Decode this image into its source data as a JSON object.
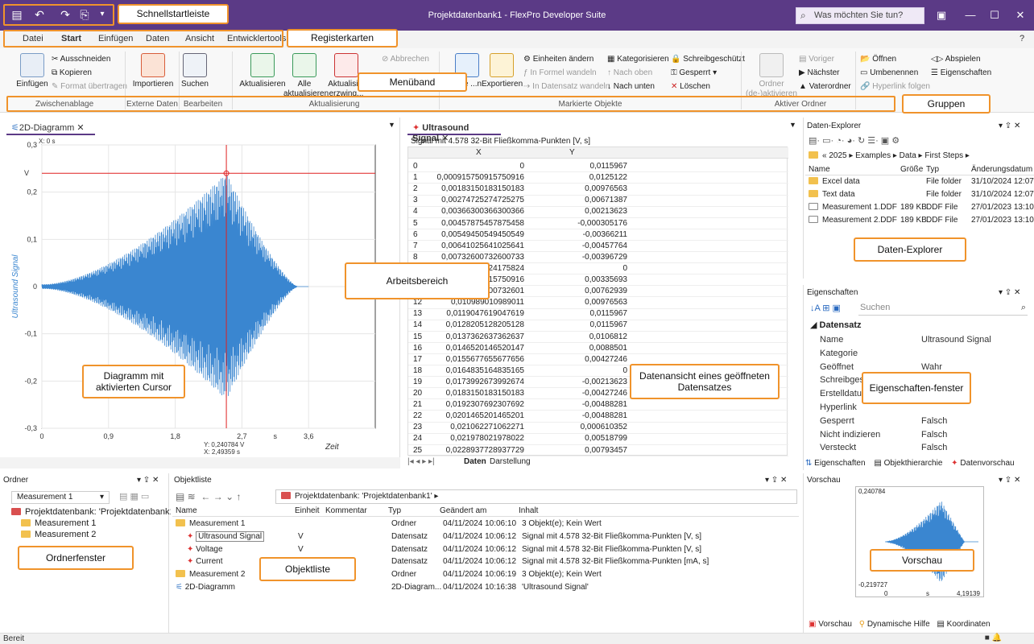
{
  "window": {
    "title": "Projektdatenbank1 - FlexPro Developer Suite",
    "search_placeholder": "Was möchten Sie tun?"
  },
  "callouts": {
    "quick_access": "Schnellstartleiste",
    "tabs": "Registerkarten",
    "ribbon": "Menüband",
    "groups": "Gruppen",
    "workspace": "Arbeitsbereich",
    "diagram_cursor": "Diagramm mit aktivierten Cursor",
    "dataset_view": "Datenansicht eines geöffneten Datensatzes",
    "explorer": "Daten-Explorer",
    "props": "Eigenschaften-fenster",
    "folder_window": "Ordnerfenster",
    "object_list": "Objektliste",
    "preview": "Vorschau"
  },
  "tabs": [
    "Datei",
    "Start",
    "Einfügen",
    "Daten",
    "Ansicht",
    "Entwicklertools"
  ],
  "ribbon": {
    "paste": "Einfügen",
    "cut": "Ausschneiden",
    "copy": "Kopieren",
    "format": "Format übertragen",
    "import": "Importieren",
    "search": "Suchen",
    "refresh": "Aktualisieren",
    "refresh_all": "Alle aktualisieren",
    "refresh_force": "Aktualisi... erzwing...",
    "cancel": "Abbrechen",
    "insert": "...ge ...n",
    "export": "Exportieren",
    "units": "Einheiten ändern",
    "to_formula": "In Formel wandeln",
    "to_dataset": "In Datensatz wandeln",
    "categorize": "Kategorisieren",
    "up": "Nach oben",
    "down": "Nach unten",
    "write_protected": "Schreibgeschützt",
    "locked": "Gesperrt",
    "delete": "Löschen",
    "folder_activate": "Ordner (de-)aktivieren",
    "prev": "Voriger",
    "next": "Nächster",
    "parent": "Vaterordner",
    "open": "Öffnen",
    "rename": "Umbenennen",
    "follow": "Hyperlink folgen",
    "play": "Abspielen",
    "properties": "Eigenschaften",
    "groups": [
      "Zwischenablage",
      "Externe Daten",
      "Bearbeiten",
      "Aktualisierung",
      "Markierte Objekte",
      "Aktiver Ordner"
    ]
  },
  "doc_tabs": {
    "diagram": "2D-Diagramm",
    "signal": "Ultrasound Signal"
  },
  "chart_data": {
    "type": "line",
    "title": "",
    "xlabel": "Zeit",
    "ylabel": "Ultrasound Signal",
    "x_unit": "s",
    "y_unit": "V",
    "xlim": [
      0,
      4.5
    ],
    "ylim": [
      -0.3,
      0.3
    ],
    "xticks": [
      "0",
      "0,9",
      "1,8",
      "2,7",
      "3,6"
    ],
    "yticks": [
      "0,3",
      "0,2",
      "0,1",
      "0",
      "-0,1",
      "-0,2",
      "-0,3"
    ],
    "cursor_x0": "X: 0 s",
    "cursor_y": "Y: 0,240784 V",
    "cursor_x": "X: 2,49359 s",
    "envelope_peak": 0.24,
    "peak_x": 2.49
  },
  "grid": {
    "caption": "Signal mit 4.578 32-Bit Fließkomma-Punkten [V, s]",
    "headers": [
      "X",
      "Y"
    ],
    "rows": [
      [
        "0",
        "0",
        "0,0115967"
      ],
      [
        "1",
        "0,000915750915750916",
        "0,0125122"
      ],
      [
        "2",
        "0,00183150183150183",
        "0,00976563"
      ],
      [
        "3",
        "0,00274725274725275",
        "0,00671387"
      ],
      [
        "4",
        "0,00366300366300366",
        "0,00213623"
      ],
      [
        "5",
        "0,00457875457875458",
        "-0,000305176"
      ],
      [
        "6",
        "0,00549450549450549",
        "-0,00366211"
      ],
      [
        "7",
        "0,00641025641025641",
        "-0,00457764"
      ],
      [
        "8",
        "0,00732600732600733",
        "-0,00396729"
      ],
      [
        "9",
        "...24175824",
        "0"
      ],
      [
        "10",
        "...15750916",
        "0,00335693"
      ],
      [
        "11",
        "...00732601",
        "0,00762939"
      ],
      [
        "12",
        "0,010989010989011",
        "0,00976563"
      ],
      [
        "13",
        "0,0119047619047619",
        "0,0115967"
      ],
      [
        "14",
        "0,0128205128205128",
        "0,0115967"
      ],
      [
        "15",
        "0,0137362637362637",
        "0,0106812"
      ],
      [
        "16",
        "0,0146520146520147",
        "0,0088501"
      ],
      [
        "17",
        "0,0155677655677656",
        "0,00427246"
      ],
      [
        "18",
        "0,0164835164835165",
        "0"
      ],
      [
        "19",
        "0,0173992673992674",
        "-0,00213623"
      ],
      [
        "20",
        "0,0183150183150183",
        "-0,00427246"
      ],
      [
        "21",
        "0,0192307692307692",
        "-0,00488281"
      ],
      [
        "22",
        "0,0201465201465201",
        "-0,00488281"
      ],
      [
        "23",
        "0,021062271062271",
        "0,000610352"
      ],
      [
        "24",
        "0,021978021978022",
        "0,00518799"
      ],
      [
        "25",
        "0,0228937728937729",
        "0,00793457"
      ]
    ],
    "sheet_tabs": [
      "Daten",
      "Darstellung"
    ]
  },
  "explorer": {
    "title": "Daten-Explorer",
    "path": [
      "«",
      "2025",
      "Examples",
      "Data",
      "First Steps"
    ],
    "cols": [
      "Name",
      "Größe",
      "Typ",
      "Änderungsdatum"
    ],
    "rows": [
      [
        "Excel data",
        "",
        "File folder",
        "31/10/2024 12:07:"
      ],
      [
        "Text data",
        "",
        "File folder",
        "31/10/2024 12:07:"
      ],
      [
        "Measurement 1.DDF",
        "189 KB",
        "DDF File",
        "27/01/2023 13:10:"
      ],
      [
        "Measurement 2.DDF",
        "189 KB",
        "DDF File",
        "27/01/2023 13:10:"
      ]
    ]
  },
  "props": {
    "title": "Eigenschaften",
    "search": "Suchen",
    "section": "Datensatz",
    "rows": [
      [
        "Name",
        "Ultrasound Signal"
      ],
      [
        "Kategorie",
        ""
      ],
      [
        "Geöffnet",
        "Wahr"
      ],
      [
        "Schreibgesc...",
        ""
      ],
      [
        "Erstelldatum",
        "...10:30"
      ],
      [
        "Hyperlink",
        ""
      ],
      [
        "Gesperrt",
        "Falsch"
      ],
      [
        "Nicht indizieren",
        "Falsch"
      ],
      [
        "Versteckt",
        "Falsch"
      ]
    ],
    "tabs": [
      "Eigenschaften",
      "Objekthierarchie",
      "Datenvorschau"
    ]
  },
  "folder": {
    "title": "Ordner",
    "select": "Measurement 1",
    "items": [
      "Projektdatenbank: 'Projektdatenbank1'",
      "Measurement 1",
      "Measurement 2"
    ]
  },
  "objlist": {
    "title": "Objektliste",
    "path": "Projektdatenbank: 'Projektdatenbank1'",
    "cols": [
      "Name",
      "Einheit",
      "Kommentar",
      "Typ",
      "Geändert am",
      "Inhalt"
    ],
    "rows": [
      [
        "Measurement 1",
        "",
        "",
        "Ordner",
        "04/11/2024 10:06:10",
        "3 Objekt(e); Kein Wert"
      ],
      [
        "Ultrasound Signal",
        "V",
        "",
        "Datensatz",
        "04/11/2024 10:06:12",
        "Signal mit 4.578 32-Bit Fließkomma-Punkten [V, s]"
      ],
      [
        "Voltage",
        "V",
        "",
        "Datensatz",
        "04/11/2024 10:06:12",
        "Signal mit 4.578 32-Bit Fließkomma-Punkten [V, s]"
      ],
      [
        "Current",
        "",
        "",
        "Datensatz",
        "04/11/2024 10:06:12",
        "Signal mit 4.578 32-Bit Fließkomma-Punkten [mA, s]"
      ],
      [
        "Measurement 2",
        "",
        "",
        "Ordner",
        "04/11/2024 10:06:19",
        "3 Objekt(e); Kein Wert"
      ],
      [
        "2D-Diagramm",
        "",
        "",
        "2D-Diagram...",
        "04/11/2024 10:16:38",
        "'Ultrasound Signal'"
      ]
    ]
  },
  "preview": {
    "title": "Vorschau",
    "ymax": "0,240784",
    "ymin": "-0,219727",
    "x0": "0",
    "xu": "s",
    "xmax": "4,19139",
    "tabs": [
      "Vorschau",
      "Dynamische Hilfe",
      "Koordinaten"
    ]
  },
  "status": "Bereit"
}
